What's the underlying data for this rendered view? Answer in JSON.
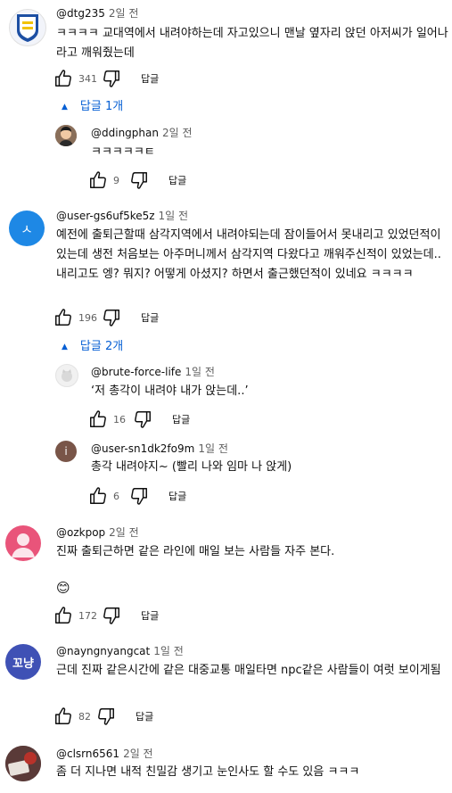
{
  "comments": [
    {
      "author": "@dtg235",
      "time": "2일 전",
      "text": "ㅋㅋㅋㅋ 교대역에서 내려야하는데 자고있으니 맨날 옆자리 앉던 아저씨가 일어나라고 깨워줬는데",
      "likes": "341",
      "reply_label": "답글",
      "replies_toggle": "답글 1개",
      "replies": [
        {
          "author": "@ddingphan",
          "time": "2일 전",
          "text": "ㅋㅋㅋㅋㅋㅌ",
          "likes": "9",
          "reply_label": "답글"
        }
      ]
    },
    {
      "author": "@user-gs6uf5ke5z",
      "time": "1일 전",
      "avatar_letter": "ㅅ",
      "text": "예전에 출퇴근할때 삼각지역에서 내려야되는데 잠이들어서 못내리고 있었던적이 있는데 생전 처음보는 아주머니께서 삼각지역 다왔다고 깨워주신적이 있었는데.. 내리고도 엥? 뭐지? 어떻게 아셨지? 하면서 출근했던적이 있네요 ㅋㅋㅋㅋ",
      "likes": "196",
      "reply_label": "답글",
      "replies_toggle": "답글 2개",
      "replies": [
        {
          "author": "@brute-force-life",
          "time": "1일 전",
          "text": "‘저 총각이 내려야 내가 앉는데..’",
          "likes": "16",
          "reply_label": "답글"
        },
        {
          "author": "@user-sn1dk2fo9m",
          "time": "1일 전",
          "avatar_letter": "i",
          "text": "총각 내려야지~ (빨리 나와 임마 나 앉게)",
          "likes": "6",
          "reply_label": "답글"
        }
      ]
    },
    {
      "author": "@ozkpop",
      "time": "2일 전",
      "text": "진짜 출퇴근하면 같은 라인에 매일 보는 사람들 자주 본다.",
      "emoji": "😊",
      "likes": "172",
      "reply_label": "답글"
    },
    {
      "author": "@nayngnyangcat",
      "time": "1일 전",
      "avatar_letter": "꼬냥",
      "text": "근데 진짜 같은시간에 같은 대중교통 매일타면 npc같은 사람들이 여럿 보이게됨",
      "likes": "82",
      "reply_label": "답글"
    },
    {
      "author": "@clsrn6561",
      "time": "2일 전",
      "text": "좀 더 지나면 내적 친밀감 생기고 눈인사도 할 수도 있음 ㅋㅋㅋ"
    }
  ],
  "colors": {
    "link_blue": "#065fd4",
    "avatar_user_gs": "#1e88e5",
    "avatar_user_sn": "#795548",
    "avatar_ozkpop": "#e9547a",
    "avatar_nayng": "#3f51b5"
  }
}
